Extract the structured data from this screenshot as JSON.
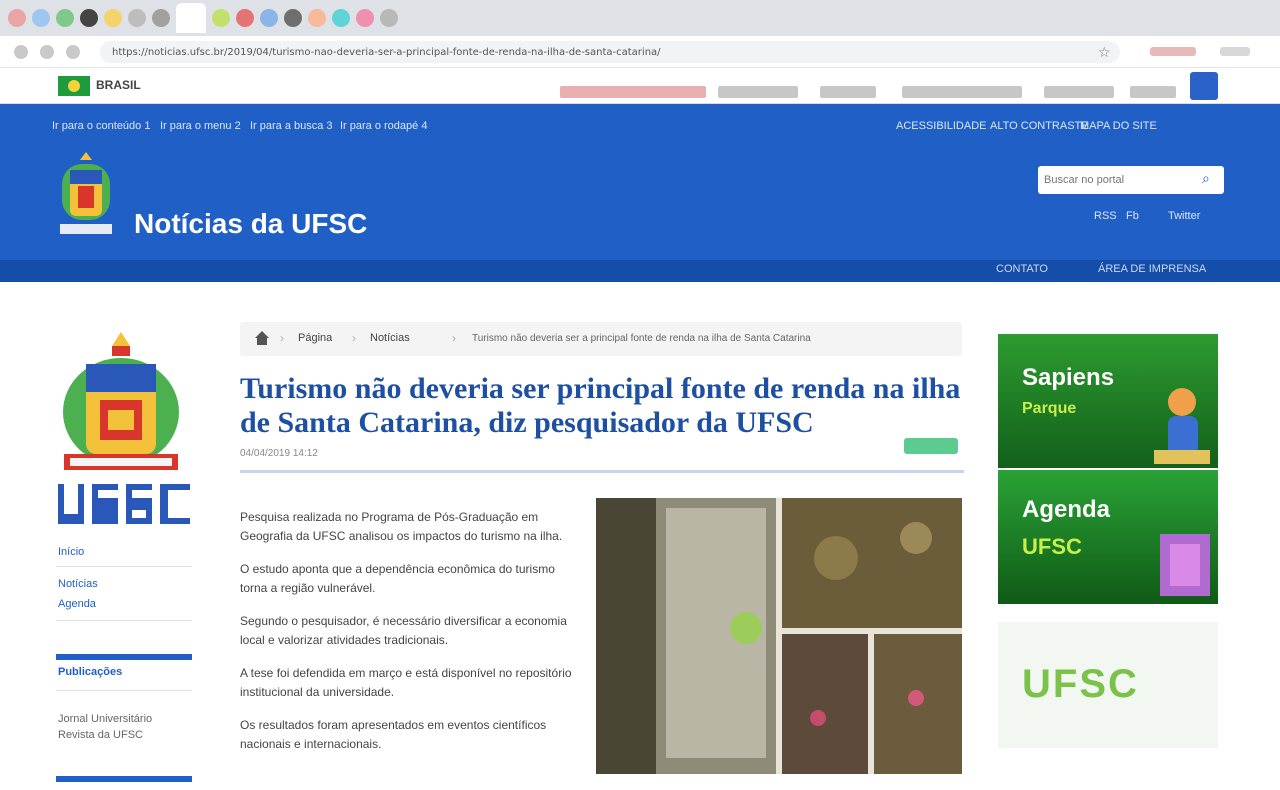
{
  "browser": {
    "url": "https://noticias.ufsc.br/2019/04/turismo-nao-deveria-ser-a-principal-fonte-de-renda-na-ilha-de-santa-catarina/",
    "tab_colors": [
      "#e9a4a4",
      "#9cc7ef",
      "#7fc98b",
      "#444444",
      "#f4d36a",
      "#bdbdbd",
      "#a0a0a0",
      "#c4e06c",
      "#e57373",
      "#8bb4e8",
      "#6e6e6e",
      "#f7b99a",
      "#5ed3d8",
      "#ef8fb1",
      "#b8b8b8"
    ]
  },
  "gov_bar": {
    "label": "BRASIL",
    "link_colors": [
      "#e8b0b0",
      "#c7c7c7",
      "#c7c7c7",
      "#c7c7c7",
      "#c7c7c7",
      "#c7c7c7"
    ]
  },
  "header": {
    "accessibility_links": [
      "Ir para o conteúdo 1",
      "Ir para o menu 2",
      "Ir para a busca 3",
      "Ir para o rodapé 4"
    ],
    "right_links": [
      "ACESSIBILIDADE",
      "ALTO CONTRASTE",
      "MAPA DO SITE"
    ],
    "site_title": "Notícias da UFSC",
    "search_placeholder": "Buscar no portal",
    "util_links": [
      "RSS",
      "Fb",
      "Twitter"
    ],
    "bottom_links": [
      "CONTATO",
      "ÁREA DE IMPRENSA"
    ],
    "brand_color": "#1f5fc6"
  },
  "sidebar": {
    "top_links": [
      "Início",
      "Notícias",
      "Agenda"
    ],
    "block_1_title": "Publicações",
    "block_1_text": [
      "Jornal Universitário",
      "Revista da UFSC"
    ]
  },
  "breadcrumb": {
    "items": [
      "Página",
      "Notícias",
      "Turismo não deveria ser a principal fonte de renda na ilha de Santa Catarina"
    ]
  },
  "article": {
    "title": "Turismo não deveria ser principal fonte de renda na ilha de Santa Catarina, diz pesquisador da UFSC",
    "date": "04/04/2019 14:12",
    "paragraphs": [
      "Pesquisa realizada no Programa de Pós-Graduação em Geografia da UFSC analisou os impactos do turismo na ilha.",
      "O estudo aponta que a dependência econômica do turismo torna a região vulnerável.",
      "Segundo o pesquisador, é necessário diversificar a economia local e valorizar atividades tradicionais.",
      "A tese foi defendida em março e está disponível no repositório institucional da universidade.",
      "Os resultados foram apresentados em eventos científicos nacionais e internacionais."
    ]
  },
  "banners": {
    "banner_1_title": "Sapiens",
    "banner_1_sub": "Parque",
    "banner_2_title": "Agenda",
    "banner_2_sub": "UFSC",
    "banner_3_text": "UFSC"
  }
}
